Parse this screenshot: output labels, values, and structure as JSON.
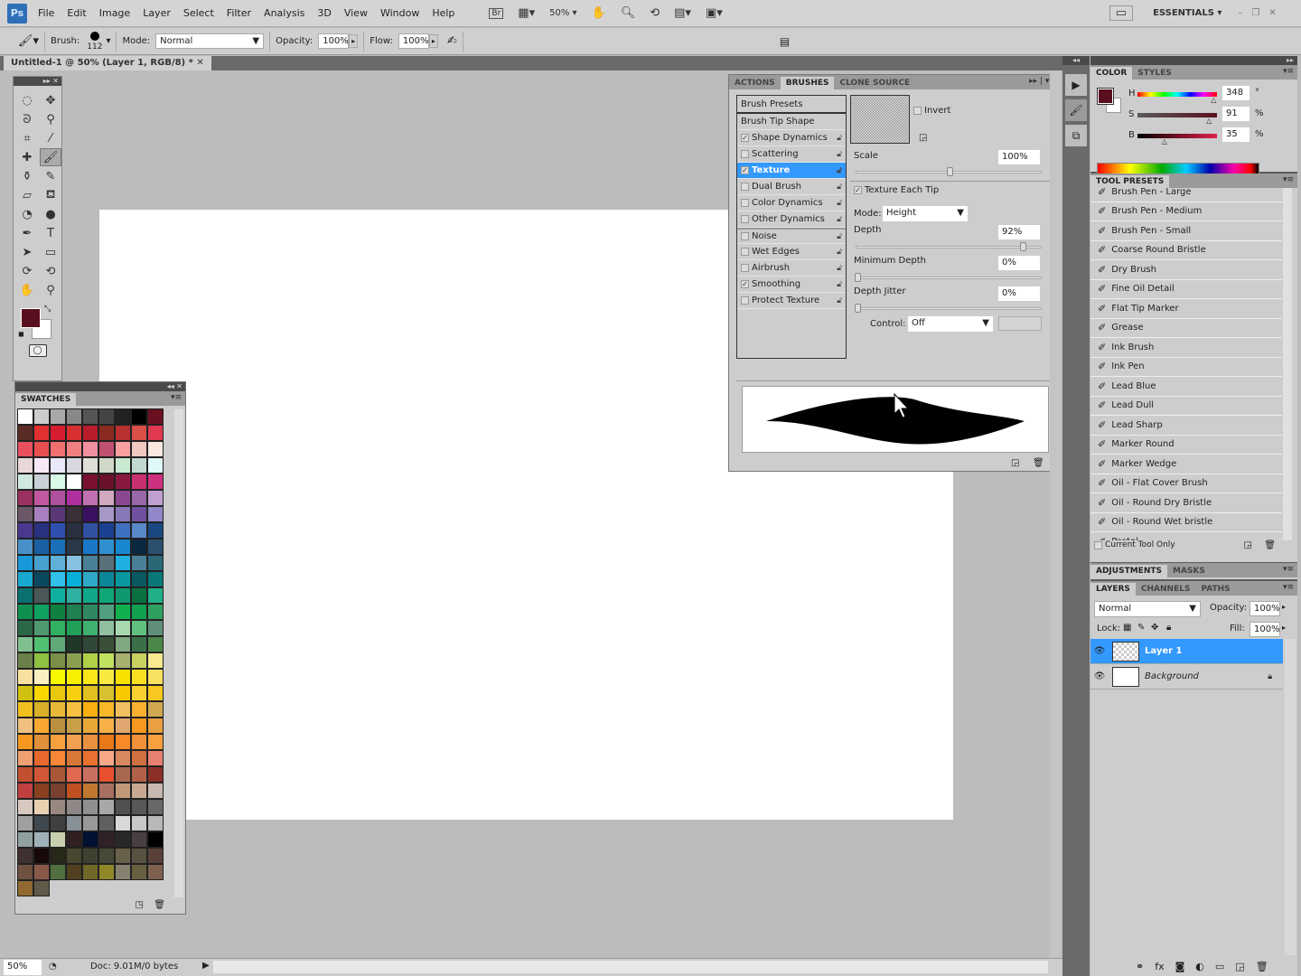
{
  "menubar": {
    "logo": "Ps",
    "items": [
      "File",
      "Edit",
      "Image",
      "Layer",
      "Select",
      "Filter",
      "Analysis",
      "3D",
      "View",
      "Window",
      "Help"
    ],
    "bridge": "Br",
    "zoom": "50%",
    "workspace": "ESSENTIALS"
  },
  "options": {
    "brush_label": "Brush:",
    "brush_size": "112",
    "mode_label": "Mode:",
    "mode": "Normal",
    "opacity_label": "Opacity:",
    "opacity": "100%",
    "flow_label": "Flow:",
    "flow": "100%"
  },
  "document": {
    "tab": "Untitled-1 @ 50% (Layer 1, RGB/8) *"
  },
  "colors": {
    "foreground": "#5a0f1e",
    "background": "#ffffff",
    "highlight": "#3399ff"
  },
  "swatches": {
    "title": "SWATCHES",
    "colors": [
      "#fff",
      "#ccc",
      "#a8a8a8",
      "#888",
      "#555",
      "#444",
      "#222",
      "#000",
      "#6a1020",
      "#5a2a25",
      "#e03030",
      "#d81c30",
      "#d83030",
      "#b81c2c",
      "#8a2a20",
      "#b83030",
      "#d85048",
      "#e03850",
      "#e85060",
      "#e85050",
      "#f07070",
      "#f08080",
      "#f090a0",
      "#c05070",
      "#f8a0a0",
      "#f0c8c0",
      "#f8e8e0",
      "#e8d8d8",
      "#f8e8f8",
      "#e8e8f8",
      "#d8d8e0",
      "#e0e0d8",
      "#d0d8c8",
      "#c8e8d0",
      "#c0d8d0",
      "#e0f8f8",
      "#d0e8e0",
      "#c8d0d8",
      "#d8f8e8",
      "#fff",
      "#7a1030",
      "#6a1028",
      "#8a1840",
      "#c83070",
      "#d03080",
      "#9a3060",
      "#c058a0",
      "#b050a0",
      "#b030a0",
      "#c070b0",
      "#d0a8c0",
      "#8a4890",
      "#9868a8",
      "#c0a0d0",
      "#6a5868",
      "#a880c0",
      "#5a3878",
      "#3a3038",
      "#3a1060",
      "#a898c8",
      "#8878b8",
      "#7050a0",
      "#9088c8",
      "#4a3890",
      "#2a3080",
      "#3050b0",
      "#2a3040",
      "#3050a0",
      "#1a4090",
      "#4070c0",
      "#5888c8",
      "#1a4880",
      "#4890c8",
      "#1a60a0",
      "#1a70b8",
      "#2a3848",
      "#1a78c8",
      "#3090d0",
      "#1888d0",
      "#0a2840",
      "#2a5070",
      "#1898d8",
      "#48a0d0",
      "#60b0d8",
      "#88c0e0",
      "#4a8098",
      "#5a7078",
      "#20b0e0",
      "#4a8098",
      "#2a6878",
      "#18a8d0",
      "#0a4860",
      "#30c0e8",
      "#08b0d8",
      "#30a8c8",
      "#0a8898",
      "#0a98a0",
      "#0a5860",
      "#0a7878",
      "#0a7070",
      "#4a5858",
      "#10b0a0",
      "#30b0a0",
      "#10a888",
      "#10a878",
      "#109870",
      "#0a7040",
      "#20b088",
      "#109050",
      "#10a060",
      "#108040",
      "#208050",
      "#308860",
      "#50a080",
      "#10b050",
      "#10a050",
      "#30a060",
      "#2a6848",
      "#509870",
      "#30b060",
      "#20a058",
      "#40b070",
      "#90c0a0",
      "#a8d8b0",
      "#60c080",
      "#60907a",
      "#80c090",
      "#50c070",
      "#60a878",
      "#203828",
      "#304838",
      "#3a5038",
      "#80a880",
      "#3a7048",
      "#4a8848",
      "#6a8048",
      "#90c040",
      "#7a9048",
      "#8aa050",
      "#b0d048",
      "#c0e060",
      "#a8b070",
      "#c8d060",
      "#f8e890",
      "#f8e0a0",
      "#f8f0c0",
      "#f8f800",
      "#f8f000",
      "#f8e818",
      "#f8e840",
      "#f8e000",
      "#f8e020",
      "#f8e060",
      "#d0c010",
      "#f8d800",
      "#e8c810",
      "#f8d010",
      "#e0c020",
      "#d8c030",
      "#f8c800",
      "#f8d030",
      "#f8c820",
      "#f0c020",
      "#d8b028",
      "#e8b838",
      "#f8c040",
      "#f8b010",
      "#f8b828",
      "#f0c060",
      "#f8b030",
      "#d0a850",
      "#f0c080",
      "#f8a830",
      "#b89040",
      "#c8a048",
      "#e8a838",
      "#f8b048",
      "#e0a870",
      "#f89820",
      "#e8a040",
      "#f89820",
      "#e09038",
      "#f8a040",
      "#f0a050",
      "#e89040",
      "#e87818",
      "#f88828",
      "#f09038",
      "#f8a040",
      "#f0a070",
      "#e86830",
      "#f88838",
      "#d87838",
      "#e87030",
      "#f8a888",
      "#d88860",
      "#d07040",
      "#e88070",
      "#c05030",
      "#d05838",
      "#a85838",
      "#e06850",
      "#c87060",
      "#e85030",
      "#a86850",
      "#b06048",
      "#8a3028",
      "#c04040",
      "#8a4020",
      "#7a4030",
      "#c05020",
      "#c07830",
      "#a87060",
      "#c09878",
      "#c8a890",
      "#c8b8b0",
      "#d8c8c0",
      "#e8d0b0",
      "#988880",
      "#908888",
      "#909090",
      "#a8a8a8",
      "#505050",
      "#585858",
      "#686868",
      "#a0a0a0",
      "#404850",
      "#404040",
      "#889098",
      "#989898",
      "#606060",
      "#d8d8d8",
      "#c8c8c8",
      "#b8b8b8",
      "#90a0a0",
      "#a0b0b8",
      "#c8d0b0",
      "#302020",
      "#001030",
      "#302028",
      "#282828",
      "#484040",
      "#000",
      "#403030",
      "#180808",
      "#282818",
      "#484830",
      "#404030",
      "#484838",
      "#686048",
      "#585040",
      "#584038",
      "#705040",
      "#8a5848",
      "#507040",
      "#504020",
      "#706828",
      "#908828",
      "#888070",
      "#686040",
      "#806050",
      "#906830",
      "#605848"
    ]
  },
  "brushes": {
    "tabs": [
      "ACTIONS",
      "BRUSHES",
      "CLONE SOURCE"
    ],
    "presets": "Brush Presets",
    "tip_shape": "Brush Tip Shape",
    "options": [
      {
        "label": "Shape Dynamics",
        "checked": true
      },
      {
        "label": "Scattering",
        "checked": false
      },
      {
        "label": "Texture",
        "checked": true,
        "selected": true
      },
      {
        "label": "Dual Brush",
        "checked": false
      },
      {
        "label": "Color Dynamics",
        "checked": false
      },
      {
        "label": "Other Dynamics",
        "checked": false
      },
      {
        "label": "Noise",
        "checked": false
      },
      {
        "label": "Wet Edges",
        "checked": false
      },
      {
        "label": "Airbrush",
        "checked": false
      },
      {
        "label": "Smoothing",
        "checked": true
      },
      {
        "label": "Protect Texture",
        "checked": false
      }
    ],
    "invert": "Invert",
    "scale_label": "Scale",
    "scale": "100%",
    "scale_pct": 50,
    "texture_each_tip": "Texture Each Tip",
    "mode_label": "Mode:",
    "mode": "Height",
    "depth_label": "Depth",
    "depth": "92%",
    "depth_pct": 92,
    "min_depth_label": "Minimum Depth",
    "min_depth": "0%",
    "depth_jitter_label": "Depth Jitter",
    "depth_jitter": "0%",
    "control_label": "Control:",
    "control": "Off"
  },
  "color_panel": {
    "tabs": [
      "COLOR",
      "STYLES"
    ],
    "h_label": "H",
    "h": "348",
    "h_unit": "°",
    "s_label": "S",
    "s": "91",
    "s_unit": "%",
    "b_label": "B",
    "b": "35",
    "b_unit": "%"
  },
  "tool_presets": {
    "title": "TOOL PRESETS",
    "items": [
      "Brush Pen - Large",
      "Brush Pen - Medium",
      "Brush Pen - Small",
      "Coarse Round Bristle",
      "Dry Brush",
      "Fine Oil Detail",
      "Flat Tip Marker",
      "Grease",
      "Ink Brush",
      "Ink Pen",
      "Lead Blue",
      "Lead Dull",
      "Lead Sharp",
      "Marker Round",
      "Marker Wedge",
      "Oil - Flat Cover Brush",
      "Oil - Round Dry Bristle",
      "Oil - Round Wet bristle",
      "Pastel"
    ],
    "current_tool_only": "Current Tool Only"
  },
  "adjustments": {
    "tabs": [
      "ADJUSTMENTS",
      "MASKS"
    ]
  },
  "layers": {
    "tabs": [
      "LAYERS",
      "CHANNELS",
      "PATHS"
    ],
    "blend": "Normal",
    "opacity_label": "Opacity:",
    "opacity": "100%",
    "lock_label": "Lock:",
    "fill_label": "Fill:",
    "fill": "100%",
    "items": [
      {
        "name": "Layer 1",
        "selected": true
      },
      {
        "name": "Background",
        "locked": true
      }
    ]
  },
  "status": {
    "zoom": "50%",
    "doc": "Doc: 9.01M/0 bytes"
  }
}
